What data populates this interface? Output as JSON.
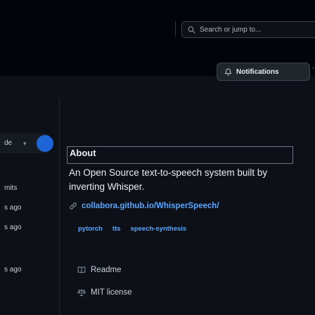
{
  "header": {
    "search_placeholder": "Search or jump to...",
    "notifications_label": "Notifications",
    "edge_fragment": "’"
  },
  "left_panel": {
    "top_fragment": "de",
    "commits_fragment": "mits",
    "rows": [
      {
        "time_fragment": "s ago"
      },
      {
        "time_fragment": "s ago"
      },
      {
        "time_fragment": "s ago"
      }
    ]
  },
  "about": {
    "heading": "About",
    "description": "An Open Source text-to-speech system built by inverting Whisper.",
    "website": "collabora.github.io/WhisperSpeech/",
    "topics": [
      "pytorch",
      "tts",
      "speech-synthesis"
    ],
    "readme_label": "Readme",
    "license_label": "MIT license"
  },
  "colors": {
    "background": "#0d1117",
    "link": "#58a6ff",
    "text": "#e6edf3"
  }
}
